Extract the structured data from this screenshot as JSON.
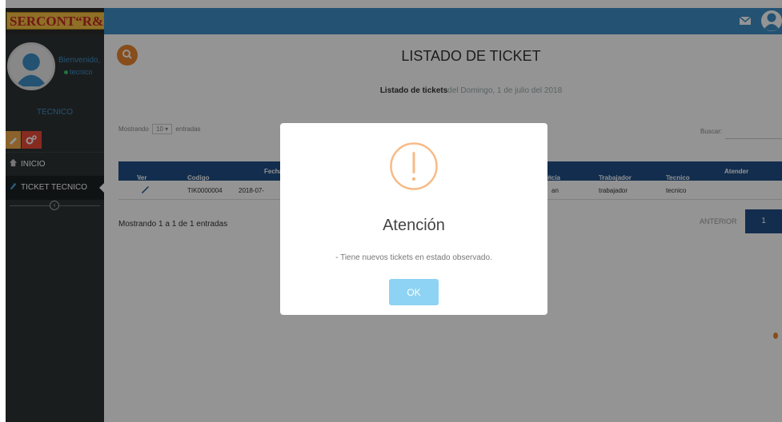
{
  "brand": {
    "name": "SERCONT",
    "suffix": "“R&D”"
  },
  "header": {
    "mail_icon": "envelope-icon",
    "user_icon": "user-circle-icon",
    "bar_color": "#3d8ec6"
  },
  "sidebar": {
    "welcome": "Bienvenido,",
    "user": "tecnico",
    "role": "TECNICO",
    "items": [
      {
        "label": "INICIO",
        "icon": "home-icon"
      },
      {
        "label": "TICKET TECNICO",
        "icon": "ticket-icon"
      }
    ]
  },
  "main": {
    "title": "LISTADO DE TICKET",
    "subtitle_label": "Listado de tickets",
    "subtitle_date": "del Domingo, 1 de julio del 2018",
    "show_prefix": "Mostrando",
    "show_value": "10",
    "show_suffix": "entradas",
    "search_label": "Buscar:",
    "search_value": "",
    "table": {
      "columns": [
        "Ver",
        "Codigo",
        "Fecha",
        "ncia",
        "Trabajador",
        "Tecnico",
        "Atender"
      ],
      "rows": [
        {
          "codigo": "TIK0000004",
          "fecha": "2018-07-",
          "incidencia": "an",
          "trabajador": "trabajador",
          "tecnico": "tecnico"
        }
      ]
    },
    "pager_info": "Mostrando 1 a 1 de 1 entradas",
    "prev_label": "ANTERIOR",
    "current_page": "1"
  },
  "modal": {
    "title": "Atención",
    "text": "- Tiene nuevos tickets en estado observado.",
    "ok_label": "OK",
    "icon": "warning-icon",
    "accent": "#f8bb86"
  }
}
